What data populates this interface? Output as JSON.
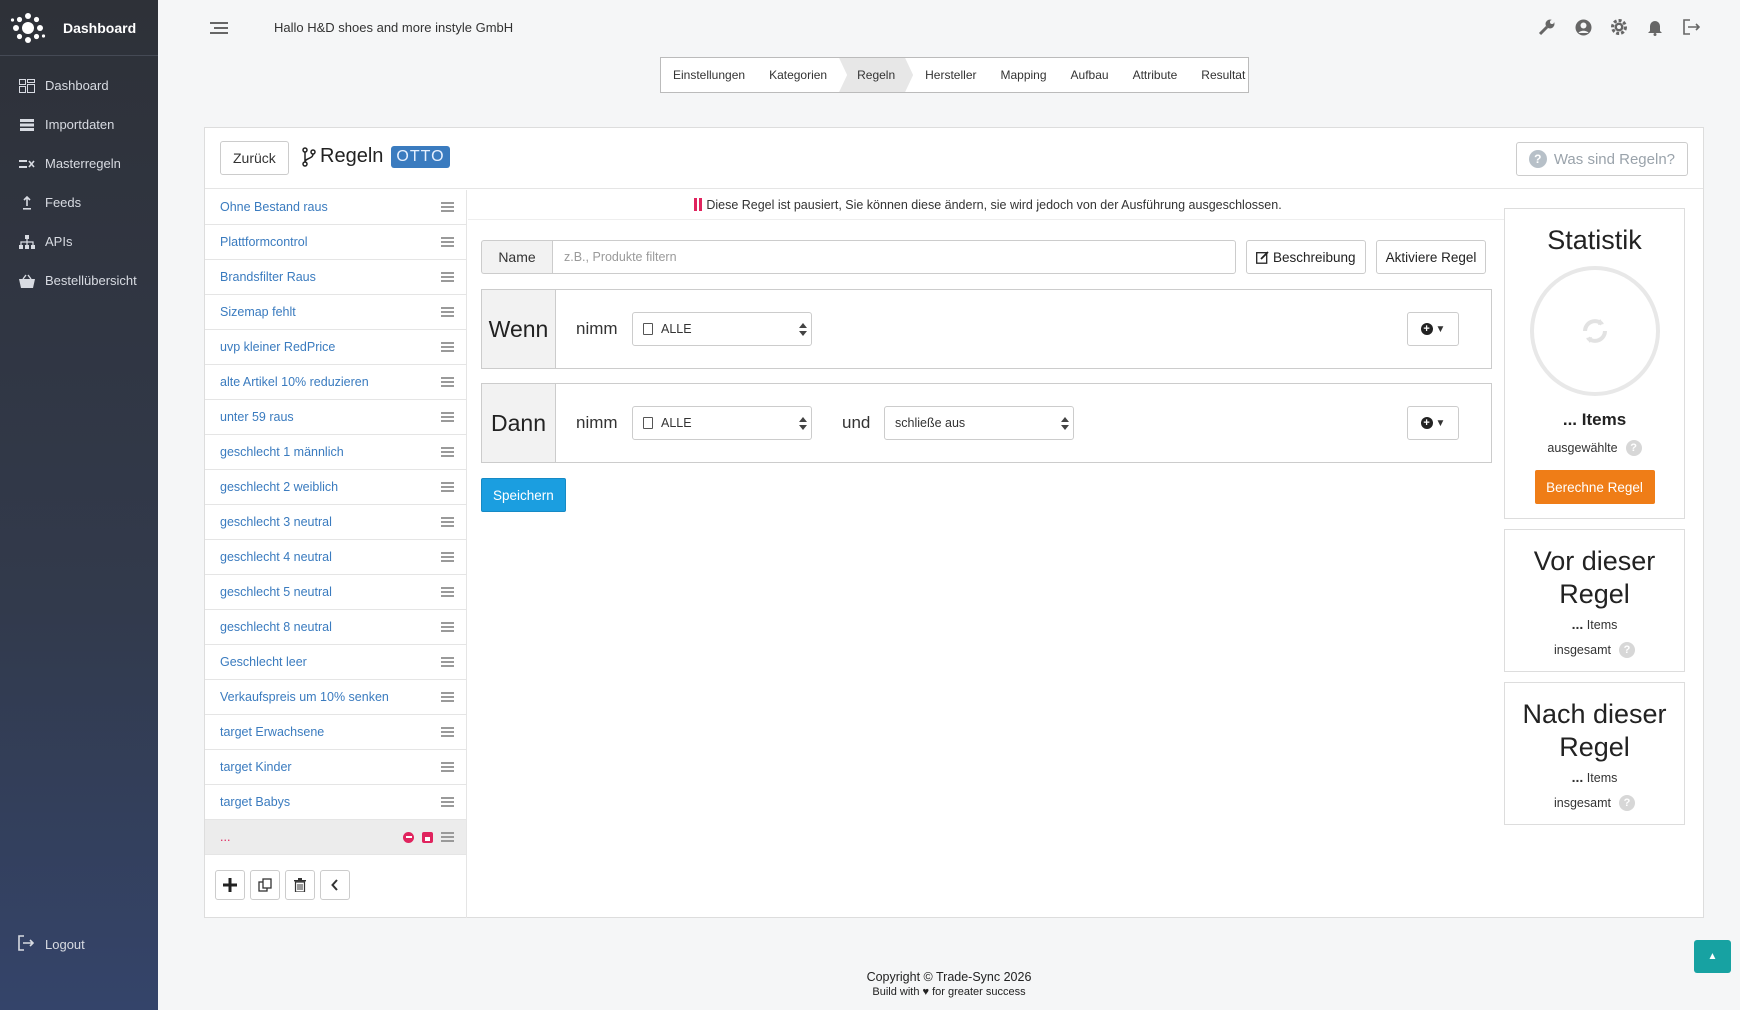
{
  "brand": {
    "name": "Dashboard"
  },
  "sidebar": {
    "items": [
      {
        "label": "Dashboard",
        "icon": "dashboard-icon"
      },
      {
        "label": "Importdaten",
        "icon": "database-icon"
      },
      {
        "label": "Masterregeln",
        "icon": "rules-icon"
      },
      {
        "label": "Feeds",
        "icon": "upload-icon"
      },
      {
        "label": "APIs",
        "icon": "sitemap-icon"
      },
      {
        "label": "Bestellübersicht",
        "icon": "basket-icon"
      }
    ],
    "logout": "Logout"
  },
  "header": {
    "greeting": "Hallo H&D shoes and more instyle GmbH"
  },
  "steps": [
    "Einstellungen",
    "Kategorien",
    "Regeln",
    "Hersteller",
    "Mapping",
    "Aufbau",
    "Attribute",
    "Resultat"
  ],
  "active_step": "Regeln",
  "card": {
    "back_label": "Zurück",
    "title": "Regeln",
    "badge": "OTTO",
    "help_label": "Was sind Regeln?"
  },
  "rules": [
    "Ohne Bestand raus",
    "Plattformcontrol",
    "Brandsfilter Raus",
    "Sizemap fehlt",
    "uvp kleiner RedPrice",
    "alte Artikel 10% reduzieren",
    "unter 59 raus",
    "geschlecht 1 männlich",
    "geschlecht 2 weiblich",
    "geschlecht 3 neutral",
    "geschlecht 4 neutral",
    "geschlecht 5 neutral",
    "geschlecht 8 neutral",
    "Geschlecht leer",
    "Verkaufspreis um 10% senken",
    "target Erwachsene",
    "target Kinder",
    "target Babys"
  ],
  "current_rule": "...",
  "notice": "Diese Regel ist pausiert, Sie können diese ändern, sie wird jedoch von der Ausführung ausgeschlossen.",
  "form": {
    "name_label": "Name",
    "name_placeholder": "z.B., Produkte filtern",
    "name_value": "",
    "desc_label": "Beschreibung",
    "activate_label": "Aktiviere Regel",
    "wenn": {
      "label": "Wenn",
      "nimm": "nimm",
      "select": "ALLE"
    },
    "dann": {
      "label": "Dann",
      "nimm": "nimm",
      "select": "ALLE",
      "und": "und",
      "action": "schließe aus"
    },
    "save_label": "Speichern"
  },
  "stats": {
    "title": "Statistik",
    "items": "... Items",
    "selected_label": "ausgewählte",
    "calc_label": "Berechne Regel",
    "before": {
      "title": "Vor dieser Regel",
      "dots": "...",
      "items": "Items",
      "total_label": "insgesamt"
    },
    "after": {
      "title": "Nach dieser Regel",
      "dots": "...",
      "items": "Items",
      "total_label": "insgesamt"
    }
  },
  "footer": {
    "copyright": "Copyright © Trade-Sync 2026",
    "build_pre": "Build with",
    "build_post": "for greater success"
  },
  "colors": {
    "accent": "#3a7bbf",
    "danger": "#e0245e",
    "primary": "#1b9ee0",
    "warning": "#ef7d17",
    "teal": "#17a2a2"
  }
}
